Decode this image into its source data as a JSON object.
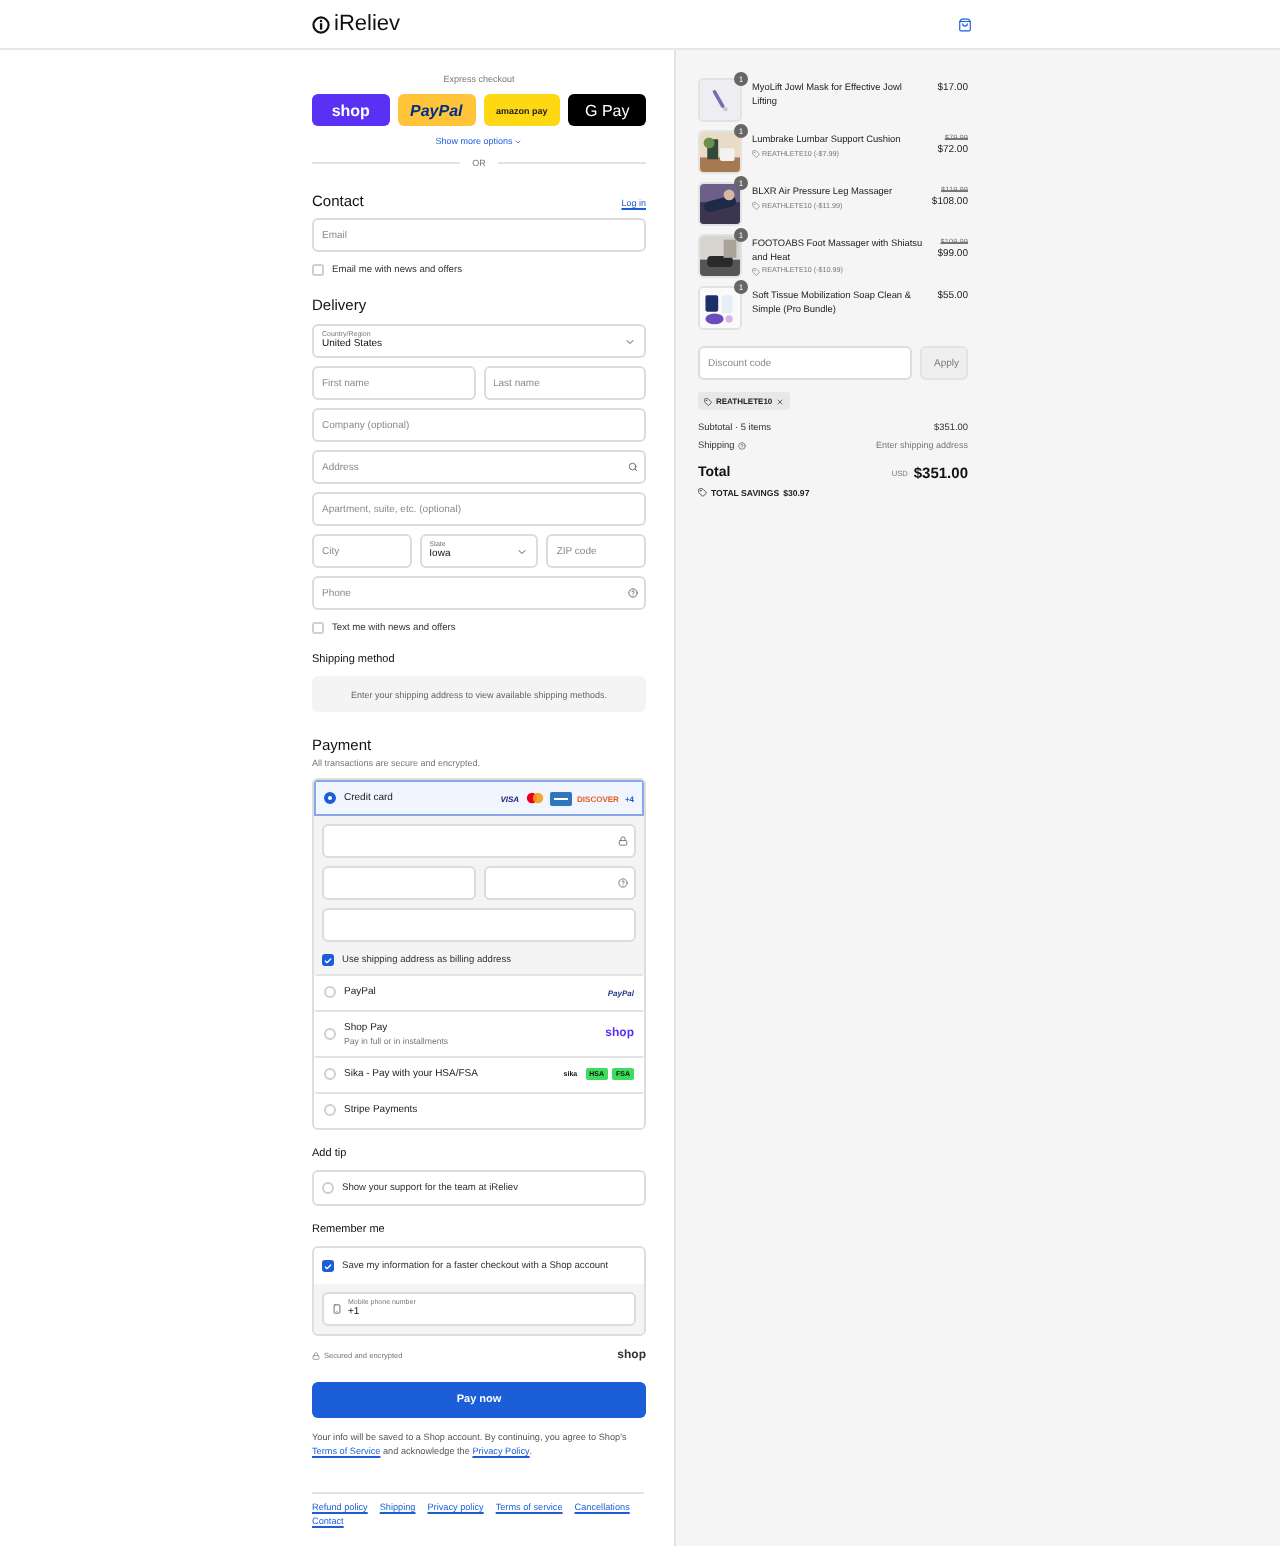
{
  "header": {
    "logo": "iReliev"
  },
  "express": {
    "label": "Express checkout",
    "more": "Show more options",
    "separator": "OR",
    "buttons": [
      {
        "kind": "shop",
        "label": "shop"
      },
      {
        "kind": "paypal",
        "label": "PayPal"
      },
      {
        "kind": "amazon",
        "label": "amazon pay"
      },
      {
        "kind": "gpay",
        "label": "G Pay"
      }
    ]
  },
  "contact": {
    "title": "Contact",
    "login": "Log in",
    "email": {
      "placeholder": "Email"
    },
    "newsletter": {
      "label": "Email me with news and offers",
      "checked": false
    }
  },
  "delivery": {
    "title": "Delivery",
    "rows": [
      [
        {
          "kind": "select",
          "label": "Country/Region",
          "value": "United States"
        }
      ],
      [
        {
          "kind": "text",
          "placeholder": "First name"
        },
        {
          "kind": "text",
          "placeholder": "Last name"
        }
      ],
      [
        {
          "kind": "text",
          "placeholder": "Company (optional)"
        }
      ],
      [
        {
          "kind": "search",
          "placeholder": "Address"
        }
      ],
      [
        {
          "kind": "text",
          "placeholder": "Apartment, suite, etc. (optional)"
        }
      ],
      [
        {
          "kind": "text",
          "placeholder": "City"
        },
        {
          "kind": "select",
          "label": "State",
          "value": "Iowa"
        },
        {
          "kind": "text",
          "placeholder": "ZIP code"
        }
      ],
      [
        {
          "kind": "help",
          "placeholder": "Phone"
        }
      ]
    ],
    "sms": {
      "label": "Text me with news and offers",
      "checked": false
    }
  },
  "shipping_method": {
    "title": "Shipping method",
    "message": "Enter your shipping address to view available shipping methods."
  },
  "payment": {
    "title": "Payment",
    "subtitle": "All transactions are secure and encrypted.",
    "methods": [
      {
        "kind": "card",
        "label": "Credit card",
        "selected": true,
        "brands": [
          "VISA",
          "DISCOVER",
          "+4"
        ],
        "card_rows": [
          [
            {
              "kind": "lock"
            }
          ],
          [
            {
              "kind": "text"
            },
            {
              "kind": "help"
            }
          ],
          [
            {
              "kind": "text"
            }
          ]
        ],
        "billing": {
          "label": "Use shipping address as billing address",
          "checked": true
        }
      },
      {
        "kind": "paypal",
        "label": "PayPal",
        "selected": false,
        "brand": "PayPal"
      },
      {
        "kind": "shop",
        "label": "Shop Pay",
        "sublabel": "Pay in full or in installments",
        "selected": false,
        "brand": "shop"
      },
      {
        "kind": "sika",
        "label": "Sika - Pay with your HSA/FSA",
        "selected": false,
        "badges": [
          "sika",
          "HSA",
          "FSA"
        ]
      },
      {
        "kind": "stripe",
        "label": "Stripe Payments",
        "selected": false
      }
    ]
  },
  "tip": {
    "title": "Add tip",
    "label": "Show your support for the team at iReliev",
    "checked": false
  },
  "remember": {
    "title": "Remember me",
    "label": "Save my information for a faster checkout with a Shop account",
    "checked": true,
    "phone": {
      "label": "Mobile phone number",
      "value": "+1"
    }
  },
  "secure": {
    "label": "Secured and encrypted",
    "brand": "shop"
  },
  "pay_button": "Pay now",
  "disclaimer": {
    "before": "Your info will be saved to a Shop account. By continuing, you agree to Shop's",
    "terms": "Terms of Service",
    "middle": "and acknowledge the",
    "privacy": "Privacy Policy",
    "after": "."
  },
  "footer_links": [
    "Refund policy",
    "Shipping",
    "Privacy policy",
    "Terms of service",
    "Cancellations",
    "Contact"
  ],
  "cart": {
    "items": [
      {
        "name": "MyoLift Jowl Mask for Effective Jowl Lifting",
        "quantity": "1",
        "price": "$17.00"
      },
      {
        "name": "Lumbrake Lumbar Support Cushion",
        "quantity": "1",
        "original": "$79.99",
        "price": "$72.00",
        "discount": "REATHLETE10 (-$7.99)"
      },
      {
        "name": "BLXR Air Pressure Leg Massager",
        "quantity": "1",
        "original": "$119.99",
        "price": "$108.00",
        "discount": "REATHLETE10 (-$11.99)"
      },
      {
        "name": "FOOTOABS Foot Massager with Shiatsu and Heat",
        "quantity": "1",
        "original": "$109.99",
        "price": "$99.00",
        "discount": "REATHLETE10 (-$10.99)"
      },
      {
        "name": "Soft Tissue Mobilization Soap Clean & Simple (Pro Bundle)",
        "quantity": "1",
        "price": "$55.00"
      }
    ],
    "discount": {
      "placeholder": "Discount code",
      "button": "Apply",
      "applied": "REATHLETE10"
    },
    "subtotal": {
      "label": "Subtotal · 5 items",
      "value": "$351.00"
    },
    "shipping": {
      "label": "Shipping",
      "value": "Enter shipping address"
    },
    "total": {
      "label": "Total",
      "currency": "USD",
      "value": "$351.00"
    },
    "savings": {
      "label": "TOTAL SAVINGS",
      "value": "$30.97"
    }
  }
}
